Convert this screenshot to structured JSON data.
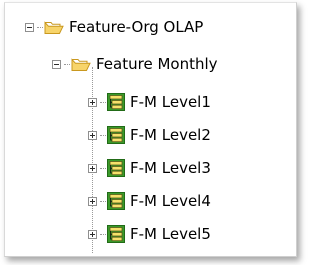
{
  "tree": {
    "root": {
      "label": "Feature-Org OLAP",
      "icon": "folder-open-icon"
    },
    "child": {
      "label": "Feature Monthly",
      "icon": "folder-open-icon"
    },
    "levels": [
      {
        "label": "F-M Level1",
        "icon": "hierarchy-level-icon"
      },
      {
        "label": "F-M Level2",
        "icon": "hierarchy-level-icon"
      },
      {
        "label": "F-M Level3",
        "icon": "hierarchy-level-icon"
      },
      {
        "label": "F-M Level4",
        "icon": "hierarchy-level-icon"
      },
      {
        "label": "F-M Level5",
        "icon": "hierarchy-level-icon"
      }
    ]
  },
  "colors": {
    "folder_fill": "#f7d46a",
    "folder_stroke": "#c9981f",
    "level_icon_green": "#3a9a2a",
    "level_icon_yellow": "#f6e16a"
  }
}
